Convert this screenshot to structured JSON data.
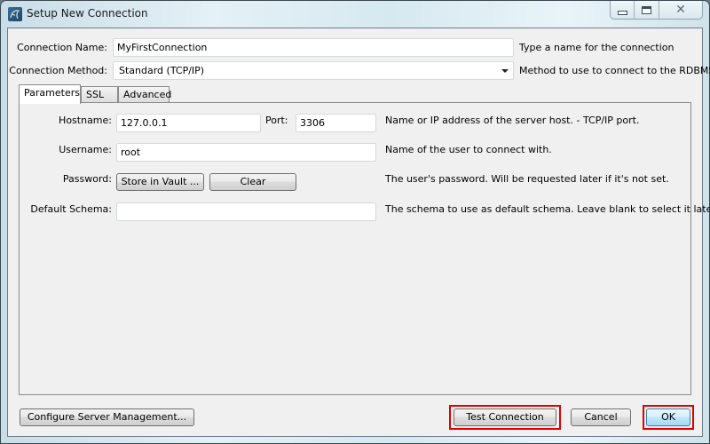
{
  "window": {
    "title": "Setup New Connection",
    "icon": "mysql-workbench-dolphin-icon",
    "controls": {
      "minimize": "minimize-icon",
      "maximize": "maximize-icon",
      "close": "close-icon",
      "close_glyph": "✕"
    }
  },
  "connection": {
    "name_label": "Connection Name:",
    "name_value": "MyFirstConnection",
    "name_hint": "Type a name for the connection",
    "method_label": "Connection Method:",
    "method_value": "Standard (TCP/IP)",
    "method_hint": "Method to use to connect to the RDBMS"
  },
  "tabs": [
    {
      "label": "Parameters",
      "active": true
    },
    {
      "label": "SSL",
      "active": false
    },
    {
      "label": "Advanced",
      "active": false
    }
  ],
  "parameters": {
    "hostname_label": "Hostname:",
    "hostname_value": "127.0.0.1",
    "port_label": "Port:",
    "port_value": "3306",
    "hostname_hint": "Name or IP address of the server host. - TCP/IP port.",
    "username_label": "Username:",
    "username_value": "root",
    "username_hint": "Name of the user to connect with.",
    "password_label": "Password:",
    "store_vault_label": "Store in Vault ...",
    "clear_label": "Clear",
    "password_hint": "The user's password. Will be requested later if it's not set.",
    "schema_label": "Default Schema:",
    "schema_value": "",
    "schema_hint": "The schema to use as default schema. Leave blank to select it later."
  },
  "footer": {
    "configure_label": "Configure Server Management...",
    "test_label": "Test Connection",
    "cancel_label": "Cancel",
    "ok_label": "OK",
    "highlight_color": "#e00000"
  }
}
